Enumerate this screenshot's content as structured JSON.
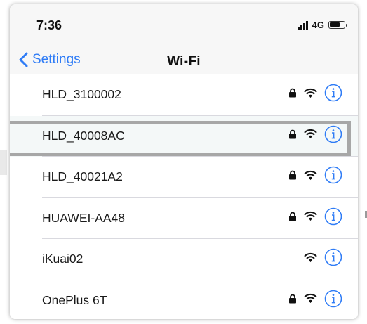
{
  "status_bar": {
    "time": "7:36",
    "network": "4G"
  },
  "nav": {
    "back_label": "Settings",
    "title": "Wi-Fi"
  },
  "networks": [
    {
      "name": "HLD_3100002",
      "secured": true
    },
    {
      "name": "HLD_40008AC",
      "secured": true
    },
    {
      "name": "HLD_40021A2",
      "secured": true
    },
    {
      "name": "HUAWEI-AA48",
      "secured": true
    },
    {
      "name": "iKuai02",
      "secured": false
    },
    {
      "name": "OnePlus 6T",
      "secured": true
    }
  ],
  "colors": {
    "accent": "#2f7cf6",
    "highlight_border": "#a7a7a7"
  },
  "icons": {
    "back": "chevron-left-icon",
    "lock": "lock-icon",
    "wifi": "wifi-icon",
    "info": "info-icon"
  }
}
